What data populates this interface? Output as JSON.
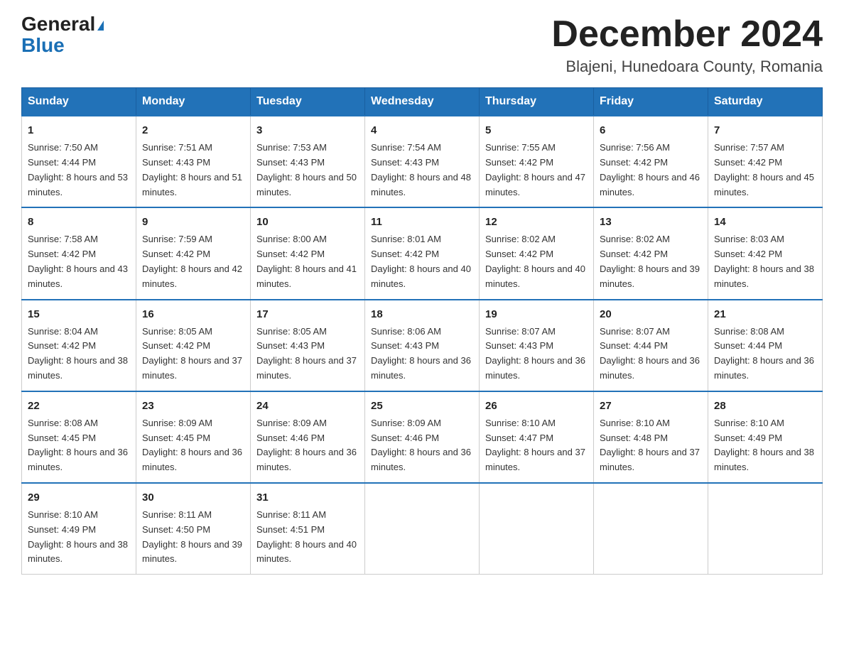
{
  "header": {
    "logo_general": "General",
    "logo_blue": "Blue",
    "month_title": "December 2024",
    "location": "Blajeni, Hunedoara County, Romania"
  },
  "days_of_week": [
    "Sunday",
    "Monday",
    "Tuesday",
    "Wednesday",
    "Thursday",
    "Friday",
    "Saturday"
  ],
  "weeks": [
    [
      {
        "day": "1",
        "sunrise": "7:50 AM",
        "sunset": "4:44 PM",
        "daylight": "8 hours and 53 minutes."
      },
      {
        "day": "2",
        "sunrise": "7:51 AM",
        "sunset": "4:43 PM",
        "daylight": "8 hours and 51 minutes."
      },
      {
        "day": "3",
        "sunrise": "7:53 AM",
        "sunset": "4:43 PM",
        "daylight": "8 hours and 50 minutes."
      },
      {
        "day": "4",
        "sunrise": "7:54 AM",
        "sunset": "4:43 PM",
        "daylight": "8 hours and 48 minutes."
      },
      {
        "day": "5",
        "sunrise": "7:55 AM",
        "sunset": "4:42 PM",
        "daylight": "8 hours and 47 minutes."
      },
      {
        "day": "6",
        "sunrise": "7:56 AM",
        "sunset": "4:42 PM",
        "daylight": "8 hours and 46 minutes."
      },
      {
        "day": "7",
        "sunrise": "7:57 AM",
        "sunset": "4:42 PM",
        "daylight": "8 hours and 45 minutes."
      }
    ],
    [
      {
        "day": "8",
        "sunrise": "7:58 AM",
        "sunset": "4:42 PM",
        "daylight": "8 hours and 43 minutes."
      },
      {
        "day": "9",
        "sunrise": "7:59 AM",
        "sunset": "4:42 PM",
        "daylight": "8 hours and 42 minutes."
      },
      {
        "day": "10",
        "sunrise": "8:00 AM",
        "sunset": "4:42 PM",
        "daylight": "8 hours and 41 minutes."
      },
      {
        "day": "11",
        "sunrise": "8:01 AM",
        "sunset": "4:42 PM",
        "daylight": "8 hours and 40 minutes."
      },
      {
        "day": "12",
        "sunrise": "8:02 AM",
        "sunset": "4:42 PM",
        "daylight": "8 hours and 40 minutes."
      },
      {
        "day": "13",
        "sunrise": "8:02 AM",
        "sunset": "4:42 PM",
        "daylight": "8 hours and 39 minutes."
      },
      {
        "day": "14",
        "sunrise": "8:03 AM",
        "sunset": "4:42 PM",
        "daylight": "8 hours and 38 minutes."
      }
    ],
    [
      {
        "day": "15",
        "sunrise": "8:04 AM",
        "sunset": "4:42 PM",
        "daylight": "8 hours and 38 minutes."
      },
      {
        "day": "16",
        "sunrise": "8:05 AM",
        "sunset": "4:42 PM",
        "daylight": "8 hours and 37 minutes."
      },
      {
        "day": "17",
        "sunrise": "8:05 AM",
        "sunset": "4:43 PM",
        "daylight": "8 hours and 37 minutes."
      },
      {
        "day": "18",
        "sunrise": "8:06 AM",
        "sunset": "4:43 PM",
        "daylight": "8 hours and 36 minutes."
      },
      {
        "day": "19",
        "sunrise": "8:07 AM",
        "sunset": "4:43 PM",
        "daylight": "8 hours and 36 minutes."
      },
      {
        "day": "20",
        "sunrise": "8:07 AM",
        "sunset": "4:44 PM",
        "daylight": "8 hours and 36 minutes."
      },
      {
        "day": "21",
        "sunrise": "8:08 AM",
        "sunset": "4:44 PM",
        "daylight": "8 hours and 36 minutes."
      }
    ],
    [
      {
        "day": "22",
        "sunrise": "8:08 AM",
        "sunset": "4:45 PM",
        "daylight": "8 hours and 36 minutes."
      },
      {
        "day": "23",
        "sunrise": "8:09 AM",
        "sunset": "4:45 PM",
        "daylight": "8 hours and 36 minutes."
      },
      {
        "day": "24",
        "sunrise": "8:09 AM",
        "sunset": "4:46 PM",
        "daylight": "8 hours and 36 minutes."
      },
      {
        "day": "25",
        "sunrise": "8:09 AM",
        "sunset": "4:46 PM",
        "daylight": "8 hours and 36 minutes."
      },
      {
        "day": "26",
        "sunrise": "8:10 AM",
        "sunset": "4:47 PM",
        "daylight": "8 hours and 37 minutes."
      },
      {
        "day": "27",
        "sunrise": "8:10 AM",
        "sunset": "4:48 PM",
        "daylight": "8 hours and 37 minutes."
      },
      {
        "day": "28",
        "sunrise": "8:10 AM",
        "sunset": "4:49 PM",
        "daylight": "8 hours and 38 minutes."
      }
    ],
    [
      {
        "day": "29",
        "sunrise": "8:10 AM",
        "sunset": "4:49 PM",
        "daylight": "8 hours and 38 minutes."
      },
      {
        "day": "30",
        "sunrise": "8:11 AM",
        "sunset": "4:50 PM",
        "daylight": "8 hours and 39 minutes."
      },
      {
        "day": "31",
        "sunrise": "8:11 AM",
        "sunset": "4:51 PM",
        "daylight": "8 hours and 40 minutes."
      },
      null,
      null,
      null,
      null
    ]
  ],
  "labels": {
    "sunrise": "Sunrise:",
    "sunset": "Sunset:",
    "daylight": "Daylight:"
  }
}
